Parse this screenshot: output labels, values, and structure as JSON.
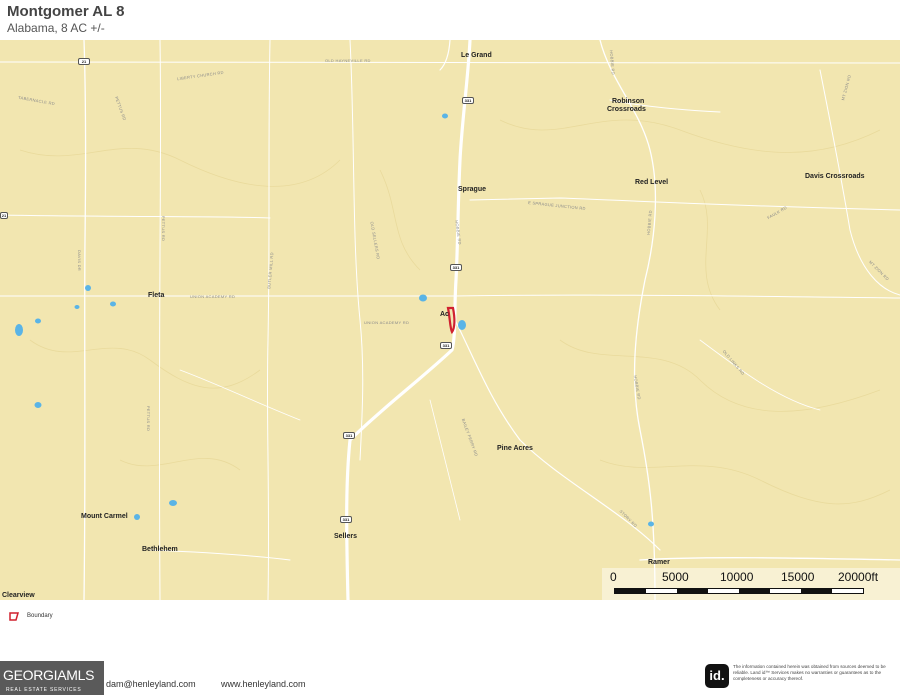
{
  "header": {
    "title": "Montgomer AL 8",
    "subtitle": "Alabama, 8 AC +/-"
  },
  "map": {
    "background_color": "#f2e6b0",
    "road_color": "#ffffff",
    "water_color": "#5ab4e6",
    "boundary_color": "#d0212f",
    "places": [
      "Le Grand",
      "Robinson",
      "Crossroads",
      "Sprague",
      "Red Level",
      "Davis Crossroads",
      "Fleta",
      "Ac",
      "Pine Acres",
      "Mount Carmel",
      "Bethlehem",
      "Sellers",
      "Ramer",
      "Clearview"
    ],
    "road_labels": [
      "OLD HAYNEVILLE RD",
      "LIBERTY CHURCH RD",
      "TABERNACLE RD",
      "PETTUS RD",
      "E SPRAGUE JUNCTION RD",
      "HOBBIE RD",
      "OLD SELLERS RD",
      "DAVIS DR",
      "PETTUS RD",
      "BUTLER MILL RD",
      "UNION ACADEMY RD",
      "UNION ACADEMY RD",
      "FAULK RD",
      "MT ZION RD",
      "MT ZION RD",
      "OLD LINKS RD",
      "HOBBIE RD",
      "HOBBIE RD",
      "BAILEY FERRY RD",
      "PETTUS RD",
      "STORY RD",
      "HOBBIE RD"
    ],
    "shields": [
      "21",
      "331",
      "331",
      "331",
      "331",
      "331"
    ]
  },
  "scale_bar": {
    "labels": [
      "0",
      "5000",
      "10000",
      "15000",
      "20000ft"
    ]
  },
  "legend": {
    "items": [
      {
        "label": "Boundary",
        "color": "#d0212f"
      }
    ]
  },
  "footer": {
    "logo_text": "GEORGIAMLS",
    "logo_tagline": "REAL ESTATE SERVICES",
    "email": "dam@henleyland.com",
    "website": "www.henleyland.com",
    "id_logo": "id.",
    "disclaimer": "The information contained herein was obtained from sources deemed to be reliable. Land id™ Services makes no warranties or guarantees as to the completeness or accuracy thereof."
  }
}
